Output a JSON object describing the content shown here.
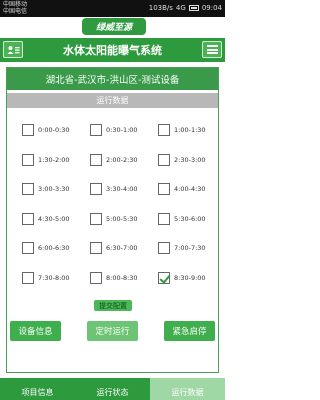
{
  "status_bar": {
    "carrier1": "中国移动",
    "carrier2": "中国电信",
    "speed": "103B/s",
    "network": "4G",
    "time": "09:04"
  },
  "logo_text": "绿威至源",
  "header": {
    "title": "水体太阳能曝气系统",
    "left_icon": "user-card-icon",
    "right_icon": "menu-icon"
  },
  "device_title": "湖北省-武汉市-洪山区-测试设备",
  "section_title": "运行数据",
  "slots": [
    {
      "label": "0:00-0:30",
      "checked": false
    },
    {
      "label": "0:30-1:00",
      "checked": false
    },
    {
      "label": "1:00-1:30",
      "checked": false
    },
    {
      "label": "1:30-2:00",
      "checked": false
    },
    {
      "label": "2:00-2:30",
      "checked": false
    },
    {
      "label": "2:30-3:00",
      "checked": false
    },
    {
      "label": "3:00-3:30",
      "checked": false
    },
    {
      "label": "3:30-4:00",
      "checked": false
    },
    {
      "label": "4:00-4:30",
      "checked": false
    },
    {
      "label": "4:30-5:00",
      "checked": false
    },
    {
      "label": "5:00-5:30",
      "checked": false
    },
    {
      "label": "5:30-6:00",
      "checked": false
    },
    {
      "label": "6:00-6:30",
      "checked": false
    },
    {
      "label": "6:30-7:00",
      "checked": false
    },
    {
      "label": "7:00-7:30",
      "checked": false
    },
    {
      "label": "7:30-8:00",
      "checked": false
    },
    {
      "label": "8:00-8:30",
      "checked": false
    },
    {
      "label": "8:30-9:00",
      "checked": true
    }
  ],
  "submit_label": "提交配置",
  "actions": {
    "device_info": "设备信息",
    "timed_run": "定时运行",
    "emergency_start": "紧急启停"
  },
  "bottom_nav": {
    "project_info": "项目信息",
    "run_status": "运行状态",
    "run_data": "运行数据"
  },
  "colors": {
    "primary_green": "#2e9a3e",
    "light_green": "#9fd7a5",
    "section_gray": "#b8b8b8"
  }
}
